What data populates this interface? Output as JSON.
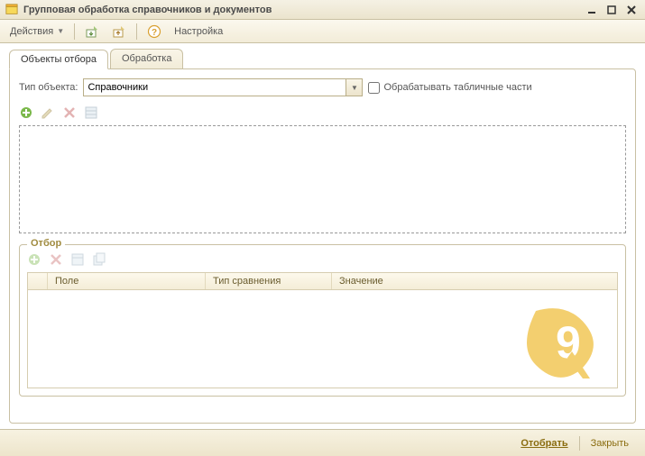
{
  "title": "Групповая обработка справочников и документов",
  "toolbar": {
    "actions": "Действия",
    "settings": "Настройка"
  },
  "tabs": {
    "selection": "Объекты отбора",
    "processing": "Обработка"
  },
  "typeRow": {
    "label": "Тип объекта:",
    "value": "Справочники",
    "checkbox": "Обрабатывать табличные части"
  },
  "filter": {
    "legend": "Отбор",
    "columns": {
      "field": "Поле",
      "comparison": "Тип сравнения",
      "value": "Значение"
    }
  },
  "footer": {
    "select": "Отобрать",
    "close": "Закрыть"
  }
}
